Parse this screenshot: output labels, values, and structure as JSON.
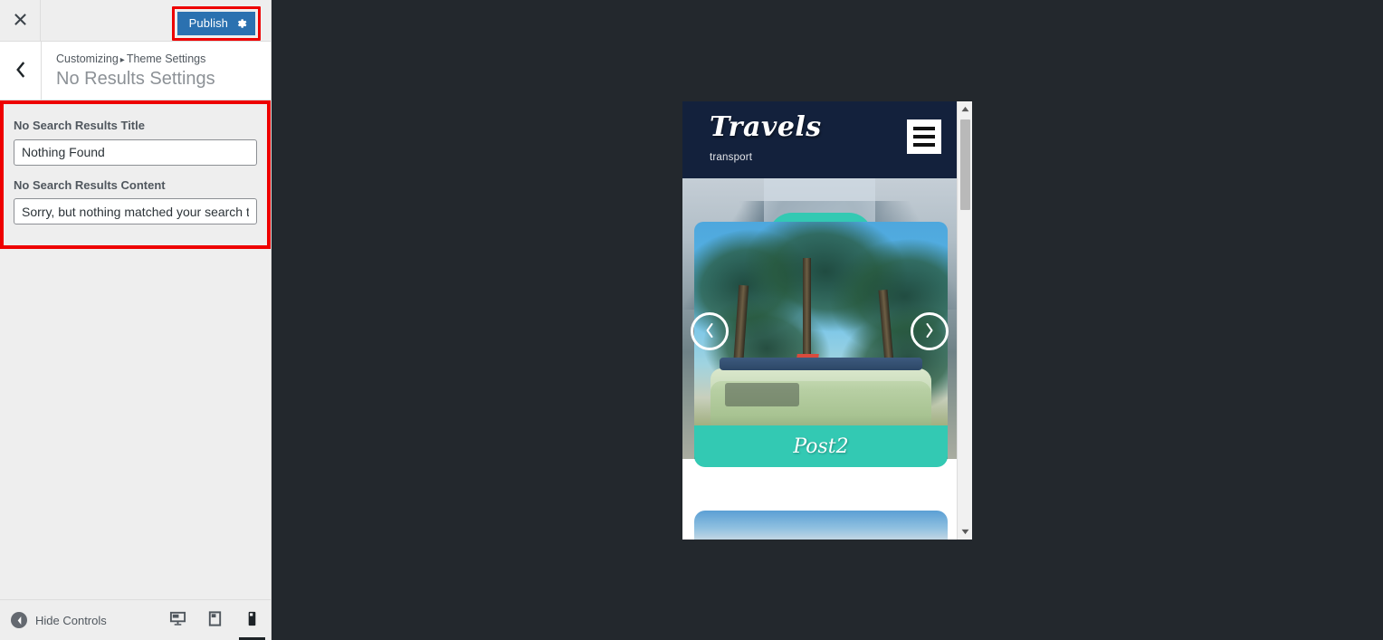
{
  "customizer": {
    "close_label": "Close",
    "publish": {
      "label": "Publish",
      "gear_name": "publish-settings-gear",
      "bg_color": "#2b71b0",
      "highlight_color": "#ee0000"
    },
    "breadcrumb": {
      "root": "Customizing",
      "separator": "▸",
      "parent": "Theme Settings"
    },
    "section_title": "No Results Settings",
    "controls": [
      {
        "label": "No Search Results Title",
        "value": "Nothing Found",
        "name": "no-search-results-title"
      },
      {
        "label": "No Search Results Content",
        "value": "Sorry, but nothing matched your search t",
        "name": "no-search-results-content"
      }
    ],
    "footer": {
      "hide_controls_label": "Hide Controls",
      "devices": [
        {
          "name": "desktop",
          "label": "Enter desktop preview mode",
          "active": false
        },
        {
          "name": "tablet",
          "label": "Enter tablet preview mode",
          "active": false
        },
        {
          "name": "mobile",
          "label": "Enter mobile preview mode",
          "active": true
        }
      ]
    }
  },
  "preview": {
    "site": {
      "brand": "Travels",
      "tagline": "transport",
      "menu_label": "Menu"
    },
    "slider": {
      "prev_label": "Previous slide",
      "next_label": "Next slide"
    },
    "posts": [
      {
        "title": "Post2",
        "accent_color": "#33c9b3"
      }
    ]
  }
}
